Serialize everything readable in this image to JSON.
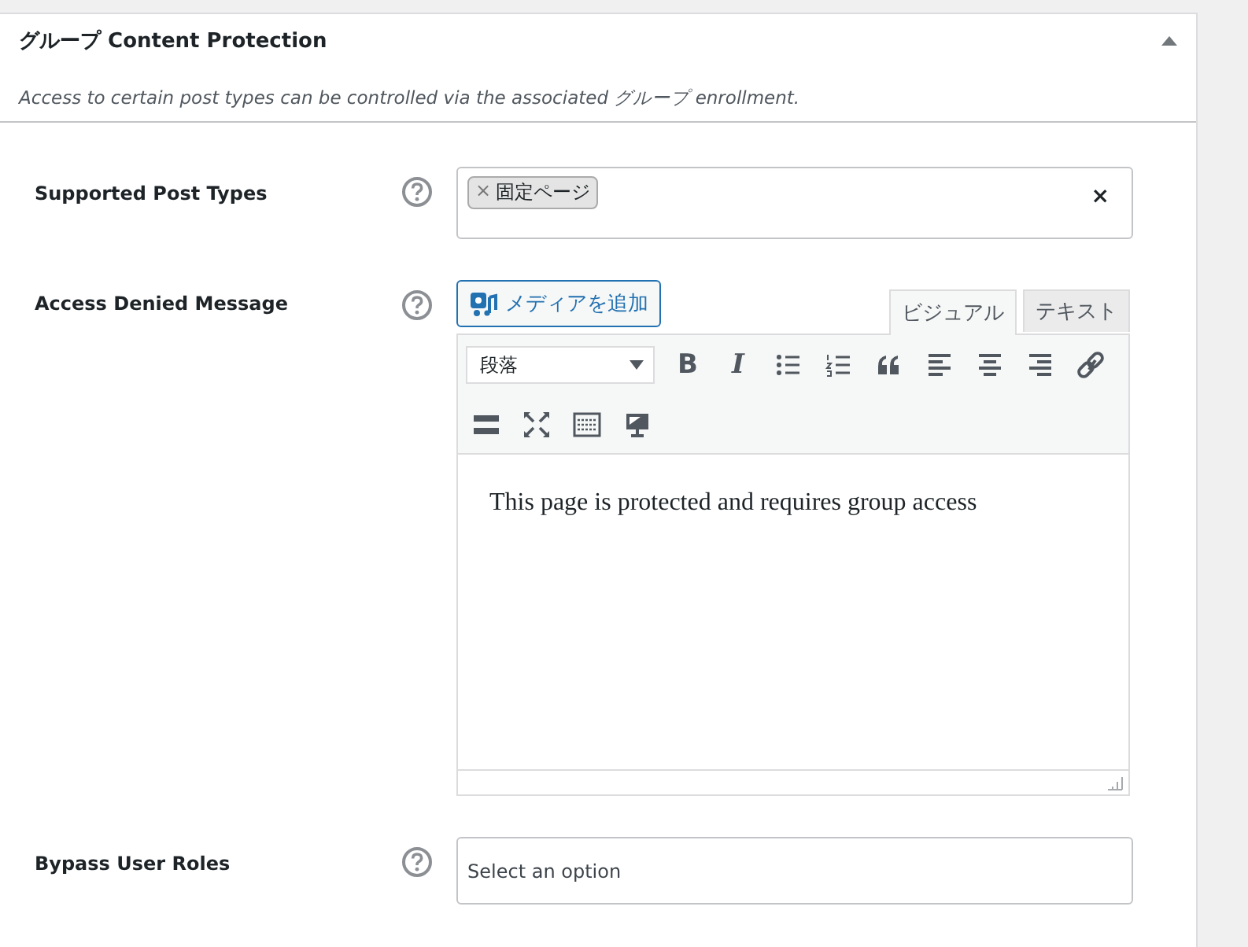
{
  "panel": {
    "title": "グループ Content Protection",
    "expanded": true,
    "description": "Access to certain post types can be controlled via the associated グループ enrollment."
  },
  "fields": [
    {
      "kind": "multiselect",
      "label": "Supported Post Types",
      "tags": [
        "固定ページ"
      ],
      "clear": "×",
      "tag_remove": "×"
    },
    {
      "kind": "editor",
      "label": "Access Denied Message",
      "media_button": "メディアを追加",
      "tabs": [
        {
          "label": "ビジュアル",
          "selected": true
        },
        {
          "label": "テキスト",
          "selected": false
        }
      ],
      "format": "段落",
      "glyphs": [
        "B",
        "I"
      ],
      "content": "This page is protected and requires group access"
    },
    {
      "kind": "select",
      "label": "Bypass User Roles",
      "placeholder": "Select an option"
    }
  ]
}
